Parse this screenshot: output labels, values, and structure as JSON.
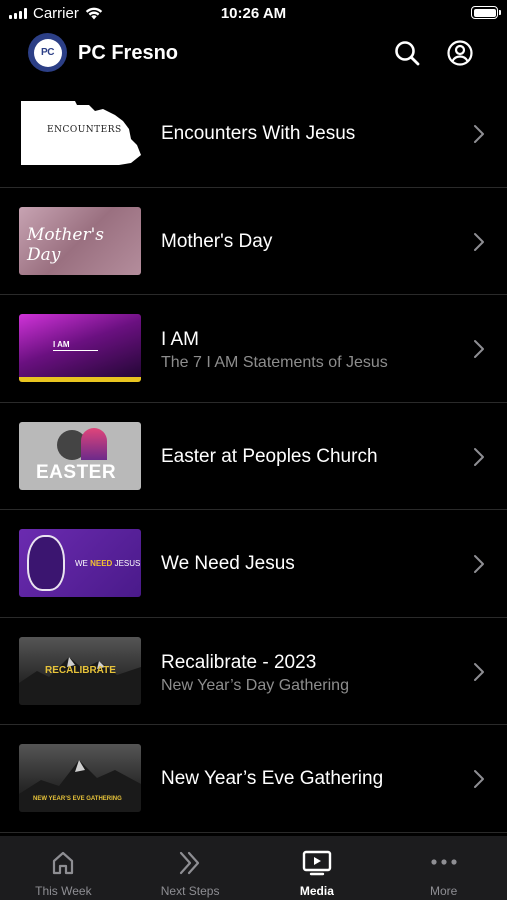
{
  "status_bar": {
    "carrier": "Carrier",
    "time": "10:26 AM"
  },
  "header": {
    "logo_text": "PC",
    "title": "PC Fresno"
  },
  "items": [
    {
      "title": "Encounters With Jesus",
      "subtitle": "",
      "thumb_text": "ENCOUNTERS"
    },
    {
      "title": "Mother's Day",
      "subtitle": "",
      "thumb_text": "Mother's Day"
    },
    {
      "title": "I AM",
      "subtitle": "The 7 I AM Statements of Jesus",
      "thumb_text": "I AM"
    },
    {
      "title": "Easter at Peoples Church",
      "subtitle": "",
      "thumb_text": "EASTER"
    },
    {
      "title": "We Need Jesus",
      "subtitle": "",
      "thumb_text_a": "WE ",
      "thumb_text_b": "NEED",
      "thumb_text_c": " JESUS"
    },
    {
      "title": "Recalibrate - 2023",
      "subtitle": "New Year’s Day Gathering",
      "thumb_text": "RECALIBRATE"
    },
    {
      "title": "New Year’s Eve Gathering",
      "subtitle": "",
      "thumb_text": "NEW YEAR’S EVE GATHERING"
    }
  ],
  "tabs": [
    {
      "label": "This Week",
      "icon": "home-icon",
      "active": false
    },
    {
      "label": "Next Steps",
      "icon": "double-chevron-icon",
      "active": false
    },
    {
      "label": "Media",
      "icon": "play-screen-icon",
      "active": true
    },
    {
      "label": "More",
      "icon": "more-dots-icon",
      "active": false
    }
  ]
}
